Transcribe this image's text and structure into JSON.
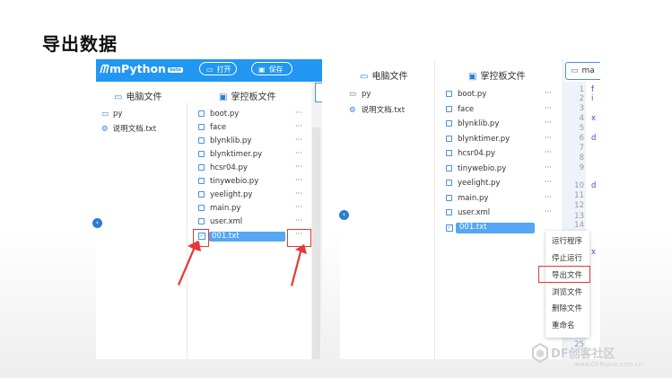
{
  "slide": {
    "title": "导出数据"
  },
  "left": {
    "app_name": "mPython",
    "version_badge": "beta",
    "toolbar": {
      "open_label": "打开",
      "save_label": "保存"
    },
    "computer_files_header": "电脑文件",
    "board_files_header": "掌控板文件",
    "computer_files": [
      {
        "name": "py",
        "icon": "folder-icon"
      },
      {
        "name": "说明文档.txt",
        "icon": "gear-icon"
      }
    ],
    "board_files": [
      "boot.py",
      "face",
      "blynklib.py",
      "blynktimer.py",
      "hcsr04.py",
      "tinywebio.py",
      "yeelight.py",
      "main.py",
      "user.xml"
    ],
    "selected_file": "001.txt",
    "more_label": "···"
  },
  "right": {
    "computer_files_header": "电脑文件",
    "board_files_header": "掌控板文件",
    "computer_files": [
      {
        "name": "py",
        "icon": "folder-icon"
      },
      {
        "name": "说明文档.txt",
        "icon": "gear-icon"
      }
    ],
    "board_files": [
      "boot.py",
      "face",
      "blynklib.py",
      "blynktimer.py",
      "hcsr04.py",
      "tinywebio.py",
      "yeelight.py",
      "main.py",
      "user.xml"
    ],
    "selected_file": "001.txt",
    "more_label": "···",
    "editor_tab": "ma",
    "line_numbers": [
      "1",
      "2",
      "3",
      "4",
      "5",
      "6",
      "7",
      "8",
      "9",
      "10",
      "11",
      "12",
      "13",
      "14"
    ],
    "code_fragments": [
      "f",
      "i",
      "x",
      "d",
      "d",
      "x"
    ],
    "bottom_line_number": "25",
    "context_menu": [
      "运行程序",
      "停止运行",
      "导出文件",
      "浏览文件",
      "删除文件",
      "重命名"
    ]
  },
  "watermark": {
    "text": "DF创客社区",
    "url": "www.DFRobot.com.cn"
  },
  "colors": {
    "accent": "#2196f3",
    "highlight": "#e53935",
    "selected": "#55a6f5"
  }
}
